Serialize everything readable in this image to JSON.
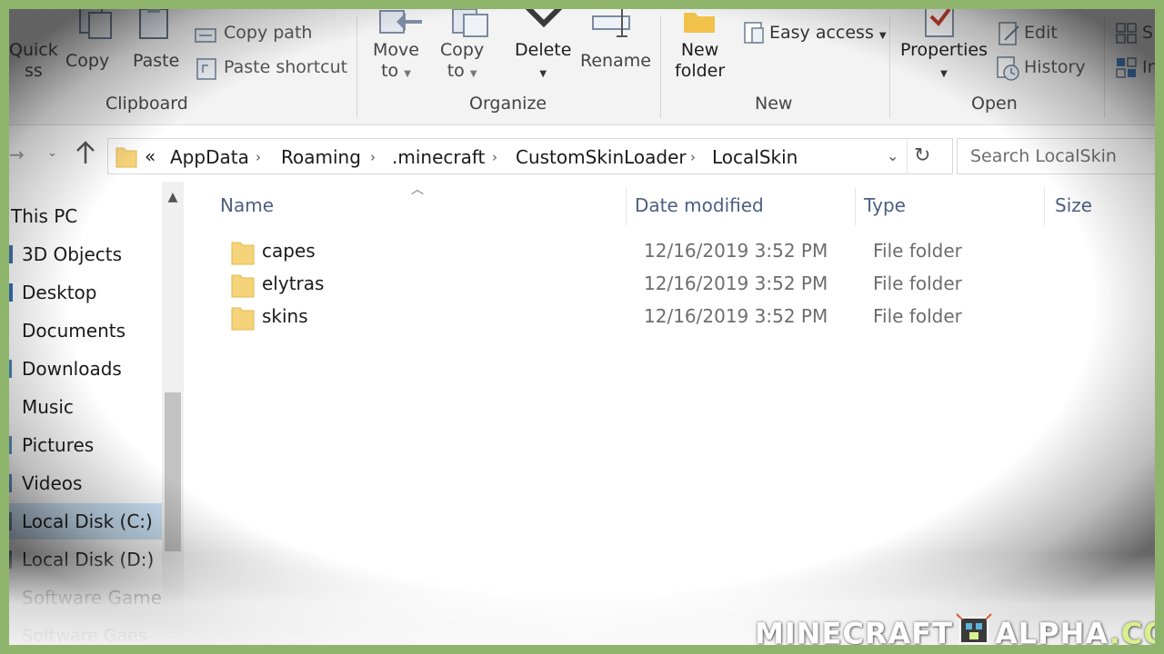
{
  "ribbon": {
    "clipboard": {
      "pin_partial": "Quick",
      "pin_partial_2": "ss",
      "copy": "Copy",
      "paste": "Paste",
      "copy_path": "Copy path",
      "paste_shortcut": "Paste shortcut",
      "group_label": "Clipboard"
    },
    "organize": {
      "move_to_1": "Move",
      "move_to_2": "to",
      "copy_to_1": "Copy",
      "copy_to_2": "to",
      "delete": "Delete",
      "rename": "Rename",
      "group_label": "Organize"
    },
    "new": {
      "new_folder_1": "New",
      "new_folder_2": "folder",
      "easy_access": "Easy access",
      "group_label": "New"
    },
    "open": {
      "properties": "Properties",
      "edit": "Edit",
      "history": "History",
      "group_label": "Open"
    },
    "select": {
      "partial_1": "S",
      "partial_2": "In"
    }
  },
  "address": {
    "overflow": "«",
    "crumbs": [
      "AppData",
      "Roaming",
      ".minecraft",
      "CustomSkinLoader",
      "LocalSkin"
    ]
  },
  "search": {
    "placeholder": "Search LocalSkin"
  },
  "nav": {
    "items": [
      {
        "label": "This PC"
      },
      {
        "label": "3D Objects"
      },
      {
        "label": "Desktop"
      },
      {
        "label": "Documents"
      },
      {
        "label": "Downloads"
      },
      {
        "label": "Music"
      },
      {
        "label": "Pictures"
      },
      {
        "label": "Videos"
      },
      {
        "label": "Local Disk (C:)"
      },
      {
        "label": "Local Disk (D:)"
      },
      {
        "label": "Software Games"
      },
      {
        "label": "Software Gaes"
      }
    ]
  },
  "list": {
    "columns": {
      "name": "Name",
      "date": "Date modified",
      "type": "Type",
      "size": "Size"
    },
    "rows": [
      {
        "name": "capes",
        "date": "12/16/2019 3:52 PM",
        "type": "File folder"
      },
      {
        "name": "elytras",
        "date": "12/16/2019 3:52 PM",
        "type": "File folder"
      },
      {
        "name": "skins",
        "date": "12/16/2019 3:52 PM",
        "type": "File folder"
      }
    ]
  },
  "watermark": {
    "left": "MINECRAFT",
    "right": "ALPHA",
    "tld": ".COM"
  },
  "colors": {
    "frame_border": "#8fb56c",
    "ribbon_bg": "#f3f3f3",
    "selection": "#cce4f7",
    "folder": "#f5d37a",
    "header_text": "#4d6082"
  }
}
